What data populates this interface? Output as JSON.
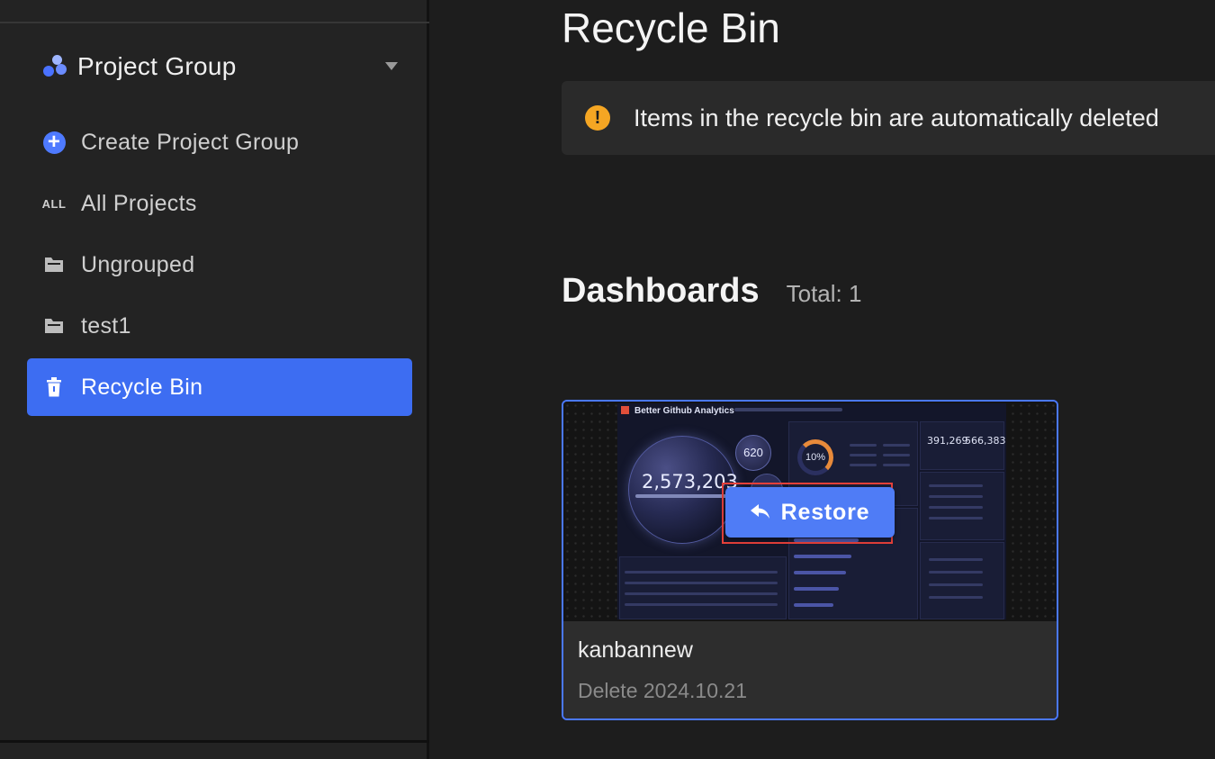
{
  "sidebar": {
    "group_title": "Project Group",
    "items": [
      {
        "label": "Create Project Group",
        "icon": "plus-circle-icon"
      },
      {
        "label": "All Projects",
        "icon": "all-icon",
        "icon_text": "ALL"
      },
      {
        "label": "Ungrouped",
        "icon": "folder-icon"
      },
      {
        "label": "test1",
        "icon": "folder-icon"
      },
      {
        "label": "Recycle Bin",
        "icon": "trash-icon",
        "active": true
      }
    ]
  },
  "main": {
    "title": "Recycle Bin",
    "notice": "Items in the recycle bin are automatically deleted",
    "section": {
      "title": "Dashboards",
      "total": "Total: 1"
    },
    "cards": [
      {
        "name": "kanbannew",
        "date": "Delete 2024.10.21",
        "restore_label": "Restore",
        "thumbnail": {
          "title": "Better Github Analytics",
          "big_number": "2,573,203",
          "small_number": "620",
          "ring_value": "10%",
          "stat_a": "391,269",
          "stat_b": "566,383"
        }
      }
    ]
  },
  "colors": {
    "accent": "#3d6df2",
    "warning": "#f5a623",
    "highlight_frame": "#e5403a"
  }
}
